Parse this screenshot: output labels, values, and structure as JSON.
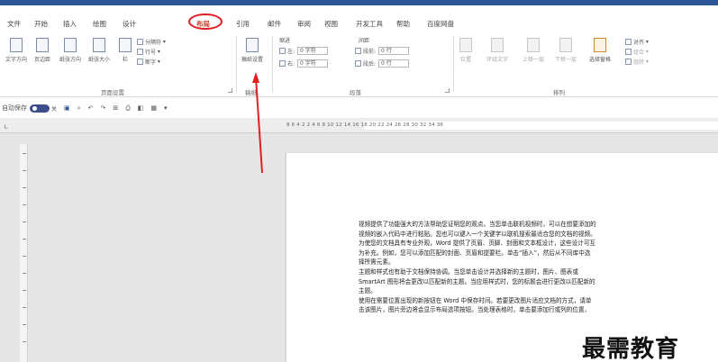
{
  "menu": {
    "tabs": [
      "文件",
      "开始",
      "插入",
      "绘图",
      "设计",
      "布局",
      "引用",
      "邮件",
      "审阅",
      "视图",
      "开发工具",
      "帮助",
      "百度网盘"
    ],
    "active_tab": "布局"
  },
  "ribbon": {
    "page_setup": {
      "text_direction": "文字方向",
      "margins": "页边距",
      "orientation": "纸张方向",
      "size": "纸张大小",
      "columns": "栏",
      "breaks": "分隔符",
      "line_numbers": "行号",
      "hyphenation": "断字",
      "group_label": "页面设置"
    },
    "manuscript": {
      "label": "稿纸设置",
      "group_label": "稿纸"
    },
    "paragraph": {
      "indent_title": "缩进",
      "spacing_title": "间距",
      "indent_left_label": "左:",
      "indent_left_value": "0 字符",
      "indent_right_label": "右:",
      "indent_right_value": "0 字符",
      "spacing_before_label": "段前:",
      "spacing_before_value": "0 行",
      "spacing_after_label": "段后:",
      "spacing_after_value": "0 行",
      "group_label": "段落"
    },
    "arrange": {
      "position": "位置",
      "wrap_text": "环绕文字",
      "bring_forward": "上移一层",
      "send_backward": "下移一层",
      "selection_pane": "选择窗格",
      "align": "对齐",
      "group": "组合",
      "rotate": "旋转",
      "group_label": "排列"
    }
  },
  "qat": {
    "autosave_label": "自动保存",
    "toggle_state": "关"
  },
  "ruler": {
    "numbers": "8  6  4  2     2  4  6  8  10  12  14  16  18  20  22  24  26  28  30  32  34  36"
  },
  "document": {
    "lines": [
      "视频提供了功能强大的方法帮助您证明您的观点。当您单击联机视频时，可以在想要添加的",
      "视频的嵌入代码中进行粘贴。您也可以键入一个关键字以联机搜索最适合您的文档的视频。",
      "为使您的文档具有专业外观，Word 提供了页眉、页脚、封面和文本框设计，这些设计可互",
      "为补充。例如，您可以添加匹配的封面、页眉和提要栏。单击“插入”，然后从不同库中选",
      "择所需元素。",
      "主题和样式也有助于文档保持协调。当您单击设计并选择新的主题时，图片、图表或",
      "SmartArt 图形将会更改以匹配新的主题。当应用样式时，您的标题会进行更改以匹配新的",
      "主题。",
      "使用在需要位置出现的新按钮在 Word 中保存时间。若要更改图片适应文档的方式，请单",
      "击该图片，图片旁边将会显示布局选项按钮。当处理表格时，单击要添加行或列的位置，"
    ]
  },
  "watermark": "最需教育",
  "colors": {
    "accent": "#2b579a",
    "highlight": "#e02020"
  }
}
